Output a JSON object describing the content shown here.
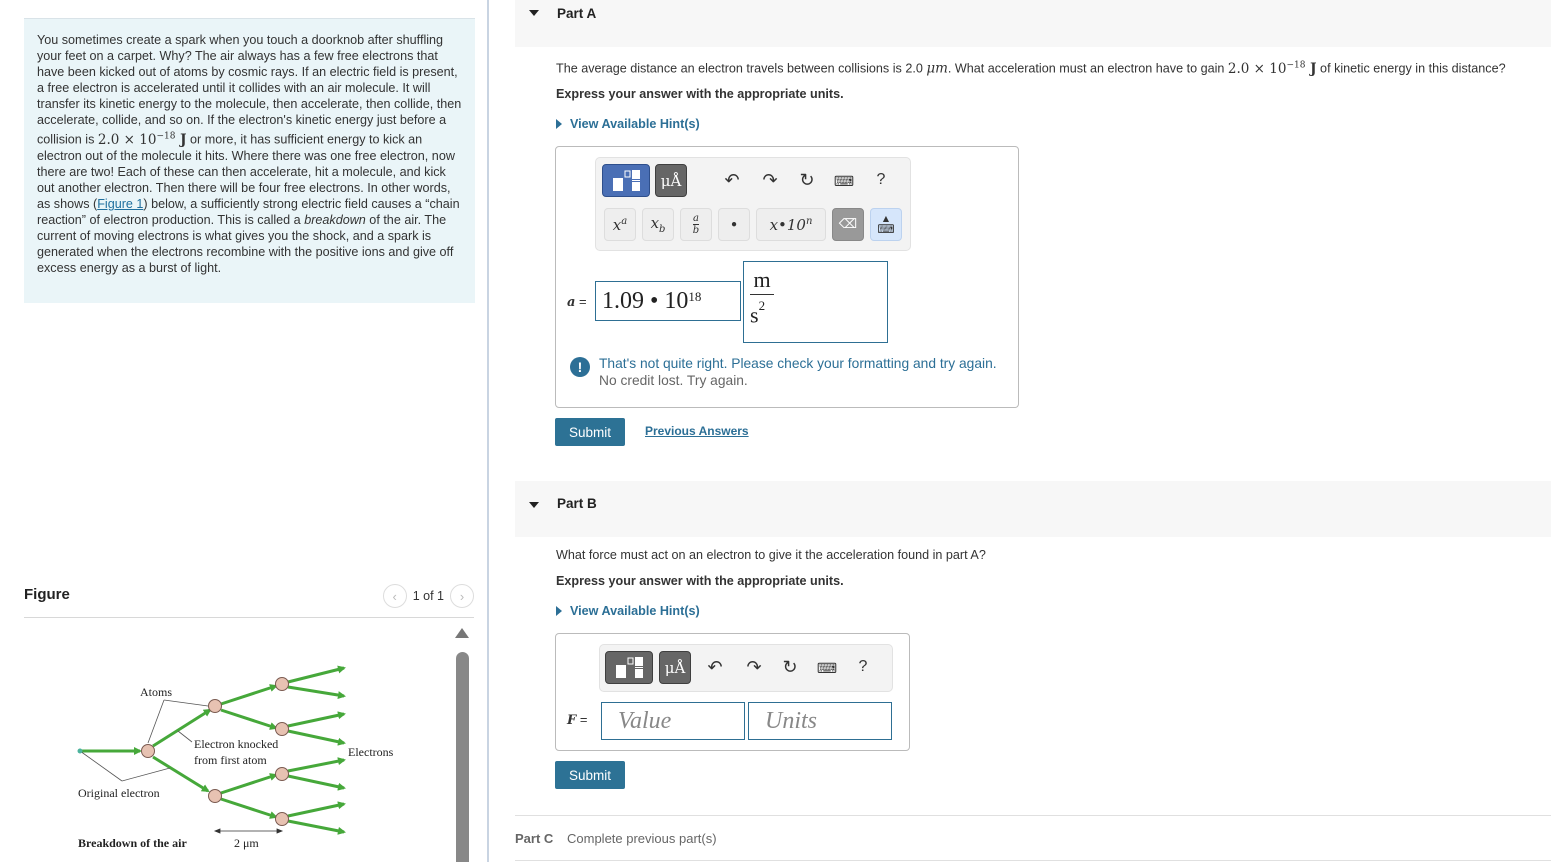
{
  "intro": {
    "p1": "You sometimes create a spark when you touch a doorknob after shuffling your feet on a carpet. Why? The air always has a few free electrons that have been kicked out of atoms by cosmic rays. If an electric field is present, a free electron is accelerated until it collides with an air molecule. It will transfer its kinetic energy to the molecule, then accelerate, then collide, then accelerate, collide, and so on. If the electron's kinetic energy just before a collision is ",
    "energy_math": "2.0 × 10",
    "energy_exp": "−18",
    "energy_unit": " J",
    "p2": " or more, it has sufficient energy to kick an electron out of the molecule it hits. Where there was one free electron, now there are two! Each of these can then accelerate, hit a molecule, and kick out another electron. Then there will be four free electrons. In other words, as shows (",
    "figure_link": "Figure 1",
    "p3": ") below, a sufficiently strong electric field causes a “chain reaction” of electron production. This is called a ",
    "p3_em": "breakdown",
    "p4": " of the air. The current of moving electrons is what gives you the shock, and a spark is generated when the electrons recombine with the positive ions and give off excess energy as a burst of light."
  },
  "figure": {
    "heading": "Figure",
    "pager": "1 of 1",
    "prev_icon": "chevron-left-icon",
    "next_icon": "chevron-right-icon",
    "labels": {
      "atoms": "Atoms",
      "knocked_1": "Electron knocked",
      "knocked_2": "from first atom",
      "electrons": "Electrons",
      "original": "Original electron",
      "caption": "Breakdown of the air",
      "scale": "2 μm"
    }
  },
  "partA": {
    "title": "Part A",
    "q_pre": "The average distance an electron travels between collisions is 2.0 ",
    "q_unit": "μm",
    "q_mid": ". What acceleration must an electron have to gain ",
    "q_math": "2.0 × 10",
    "q_exp": "−18",
    "q_j": " J",
    "q_post": " of kinetic energy in this distance?",
    "instruction": "Express your answer with the appropriate units.",
    "hint": "View Available Hint(s)",
    "toolbar": {
      "units_label": "μÅ",
      "help": "?",
      "row2": [
        "xᵃ",
        "x_b",
        "a/b",
        "•",
        "x•10ⁿ"
      ]
    },
    "var_label": "a",
    "eq": " =",
    "value_mantissa": "1.09 • 10",
    "value_exp": "18",
    "unit_num": "m",
    "unit_den": "s",
    "unit_den_exp": "2",
    "feedback_main": "That's not quite right. Please check your formatting and try again.",
    "feedback_sub": "No credit lost. Try again.",
    "submit": "Submit",
    "previous_answers": "Previous Answers"
  },
  "partB": {
    "title": "Part B",
    "question": "What force must act on an electron to give it the acceleration found in part A?",
    "instruction": "Express your answer with the appropriate units.",
    "hint": "View Available Hint(s)",
    "units_label": "μÅ",
    "help": "?",
    "var_label": "F",
    "eq": " =",
    "value_placeholder": "Value",
    "units_placeholder": "Units",
    "submit": "Submit"
  },
  "partC": {
    "title": "Part C",
    "status": "Complete previous part(s)"
  },
  "colors": {
    "accent": "#2c6f96",
    "arrow_green": "#46a83a",
    "atom_fill": "#e7c2b2"
  }
}
